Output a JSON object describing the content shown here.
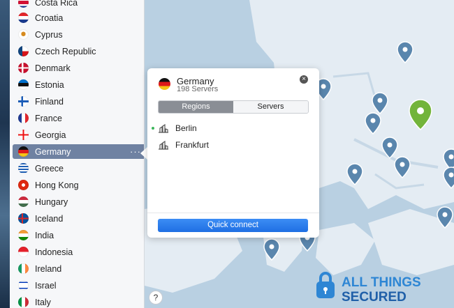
{
  "sidebar": {
    "countries": [
      {
        "name": "Costa Rica"
      },
      {
        "name": "Croatia"
      },
      {
        "name": "Cyprus"
      },
      {
        "name": "Czech Republic"
      },
      {
        "name": "Denmark"
      },
      {
        "name": "Estonia"
      },
      {
        "name": "Finland"
      },
      {
        "name": "France"
      },
      {
        "name": "Georgia"
      },
      {
        "name": "Germany",
        "active": true
      },
      {
        "name": "Greece"
      },
      {
        "name": "Hong Kong"
      },
      {
        "name": "Hungary"
      },
      {
        "name": "Iceland"
      },
      {
        "name": "India"
      },
      {
        "name": "Indonesia"
      },
      {
        "name": "Ireland"
      },
      {
        "name": "Israel"
      },
      {
        "name": "Italy"
      }
    ],
    "more_label": "···",
    "help_label": "?"
  },
  "popup": {
    "country": "Germany",
    "servers": "198 Servers",
    "close_label": "×",
    "tabs": [
      {
        "label": "Regions",
        "active": true
      },
      {
        "label": "Servers",
        "active": false
      }
    ],
    "regions": [
      {
        "name": "Berlin",
        "connected": true
      },
      {
        "name": "Frankfurt",
        "connected": false
      }
    ],
    "quick_connect_label": "Quick connect"
  },
  "branding": {
    "line1": "ALL THINGS",
    "line2": "SECURED"
  },
  "colors": {
    "accent": "#2b7de9",
    "map_land": "#e4ecf3",
    "map_sea": "#b9d0e2",
    "pin": "#5a86ad",
    "pin_active": "#72b43a",
    "brand_blue": "#2e86d4"
  }
}
